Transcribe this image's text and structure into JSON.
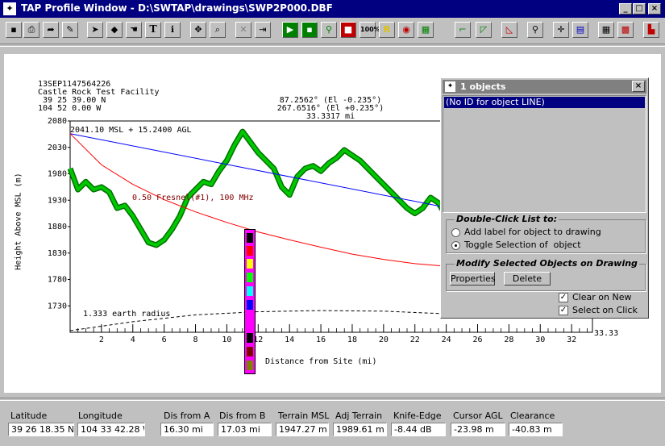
{
  "window": {
    "title": "TAP Profile Window - D:\\SWTAP\\drawings\\SWP2P000.DBF"
  },
  "toolbar": {
    "zoom_label": "100%"
  },
  "plot": {
    "header_left": [
      "13SEP1147564226",
      "Castle Rock Test Facility",
      " 39 25 39.00 N",
      "104 52 0.00 W"
    ],
    "header_right": [
      "87.2562° (El -0.235°)",
      "267.6516° (El +0.235°)",
      "33.3317 mi"
    ],
    "site_label": "2041.10 MSL + 15.2400 AGL",
    "fresnel_label": "0.50 Fresnel(#1), 100 MHz",
    "earth_label": "1.333 earth radius",
    "end_label": "33.33"
  },
  "chart_data": {
    "type": "line",
    "title": "",
    "xlabel": "Distance from Site (mi)",
    "ylabel": "Height Above MSL (m)",
    "xlim": [
      0,
      33.33
    ],
    "ylim": [
      1680,
      2080
    ],
    "x_ticks": [
      2,
      4,
      6,
      8,
      10,
      12,
      14,
      16,
      18,
      20,
      22,
      24,
      26,
      28,
      30,
      32
    ],
    "y_ticks": [
      2080,
      2030,
      1980,
      1930,
      1880,
      1830,
      1780,
      1730
    ],
    "series": [
      {
        "name": "terrain",
        "color": "#00c800",
        "x": [
          0,
          0.5,
          1,
          1.5,
          2,
          2.5,
          3,
          3.5,
          4,
          4.5,
          5,
          5.5,
          6,
          6.5,
          7,
          7.5,
          8,
          8.5,
          9,
          9.5,
          10,
          10.5,
          11,
          11.5,
          12,
          12.5,
          13,
          13.5,
          14,
          14.5,
          15,
          15.5,
          16,
          16.5,
          17,
          17.5,
          18,
          18.5,
          19,
          19.5,
          20,
          20.5,
          21,
          21.5,
          22,
          22.5,
          23,
          23.5,
          24
        ],
        "y": [
          1990,
          1950,
          1965,
          1950,
          1955,
          1945,
          1915,
          1920,
          1900,
          1875,
          1850,
          1845,
          1855,
          1875,
          1900,
          1935,
          1950,
          1965,
          1960,
          1985,
          2005,
          2035,
          2060,
          2040,
          2020,
          2005,
          1990,
          1955,
          1940,
          1975,
          1990,
          1995,
          1985,
          2000,
          2010,
          2025,
          2015,
          2005,
          1990,
          1975,
          1960,
          1945,
          1930,
          1915,
          1905,
          1915,
          1935,
          1925,
          1900
        ]
      },
      {
        "name": "path",
        "color": "#0000ff",
        "x": [
          0,
          33.33
        ],
        "y": [
          2056,
          1862
        ]
      },
      {
        "name": "fresnel",
        "color": "#ff0000",
        "x": [
          0,
          2,
          4,
          6,
          8,
          10,
          12,
          14,
          16,
          18,
          20,
          22,
          24
        ],
        "y": [
          2056,
          1997,
          1960,
          1931,
          1908,
          1888,
          1870,
          1855,
          1841,
          1828,
          1818,
          1810,
          1805
        ]
      },
      {
        "name": "earth",
        "color": "#000000",
        "x": [
          0,
          4,
          8,
          12,
          16,
          20,
          24
        ],
        "y": [
          1683,
          1700,
          1713,
          1719,
          1721,
          1720,
          1715
        ]
      }
    ]
  },
  "objects_pane": {
    "title": "1 objects",
    "list_items": [
      "(No ID for object LINE)"
    ],
    "double_click": {
      "label": "Double-Click List to:",
      "option1": "Add label for object to drawing",
      "option2": "Toggle Selection of  object"
    },
    "modify": {
      "label": "Modify Selected Objects on Drawing",
      "properties": "Properties",
      "delete": "Delete"
    },
    "clear_on_new": "Clear on New",
    "select_on_click": "Select on Click"
  },
  "status": {
    "fields": [
      {
        "label": "Latitude",
        "value": "39 26 18.35 N"
      },
      {
        "label": "Longitude",
        "value": "104 33 42.28 W"
      },
      {
        "label": "Dis from A",
        "value": "16.30 mi"
      },
      {
        "label": "Dis from B",
        "value": "17.03 mi"
      },
      {
        "label": "Terrain MSL",
        "value": "1947.27 m"
      },
      {
        "label": "Adj Terrain",
        "value": "1989.61 m"
      },
      {
        "label": "Knife-Edge",
        "value": "-8.44 dB"
      },
      {
        "label": "Cursor AGL",
        "value": "-23.98 m"
      },
      {
        "label": "Clearance",
        "value": "-40.83 m"
      }
    ]
  },
  "colors": {
    "title_bar": "#000080",
    "terrain": "#00c800",
    "path": "#0000ff",
    "fresnel": "#ff0000"
  }
}
